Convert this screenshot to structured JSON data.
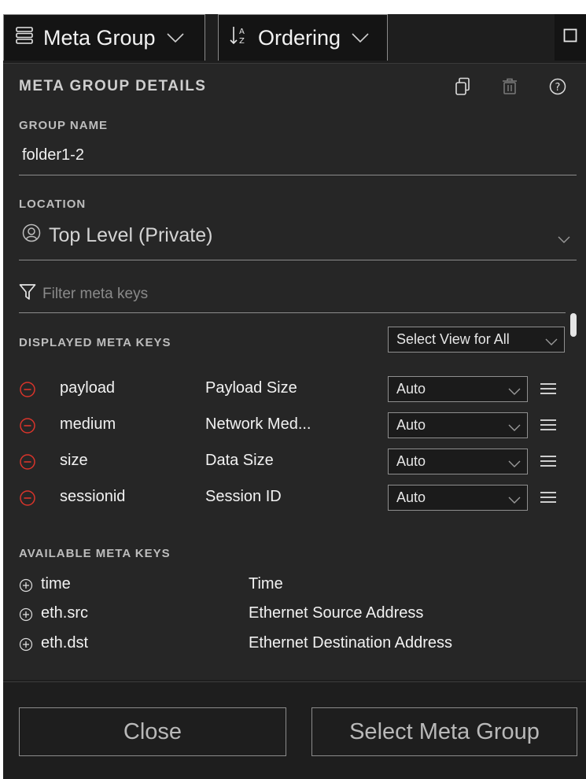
{
  "toolbar": {
    "meta_group_label": "Meta Group",
    "ordering_label": "Ordering"
  },
  "details": {
    "title": "META GROUP DETAILS",
    "group_name_label": "GROUP NAME",
    "group_name_value": "folder1-2",
    "location_label": "LOCATION",
    "location_value": "Top Level (Private)",
    "filter_placeholder": "Filter meta keys"
  },
  "displayed": {
    "title": "DISPLAYED META KEYS",
    "select_view_all": "Select View for All",
    "rows": [
      {
        "key": "payload",
        "desc": "Payload Size",
        "view": "Auto"
      },
      {
        "key": "medium",
        "desc": "Network Med...",
        "view": "Auto"
      },
      {
        "key": "size",
        "desc": "Data Size",
        "view": "Auto"
      },
      {
        "key": "sessionid",
        "desc": "Session ID",
        "view": "Auto"
      }
    ]
  },
  "available": {
    "title": "AVAILABLE META KEYS",
    "rows": [
      {
        "key": "time",
        "desc": "Time"
      },
      {
        "key": "eth.src",
        "desc": "Ethernet Source Address"
      },
      {
        "key": "eth.dst",
        "desc": "Ethernet Destination Address"
      }
    ]
  },
  "footer": {
    "close_label": "Close",
    "select_label": "Select Meta Group"
  },
  "colors": {
    "panel": "#262626",
    "toolbar": "#1e1e1e",
    "remove_icon": "#d9342b",
    "text": "#f2f2f2"
  },
  "icons": {
    "meta_group": "list-stack-icon",
    "ordering": "sort-az-icon",
    "maximize": "maximize-icon",
    "clone": "clone-icon",
    "delete": "trash-icon",
    "help": "help-icon",
    "location": "user-circle-icon",
    "filter": "filter-icon",
    "remove": "minus-circle-icon",
    "add": "plus-circle-icon",
    "reorder": "drag-handle-icon"
  }
}
